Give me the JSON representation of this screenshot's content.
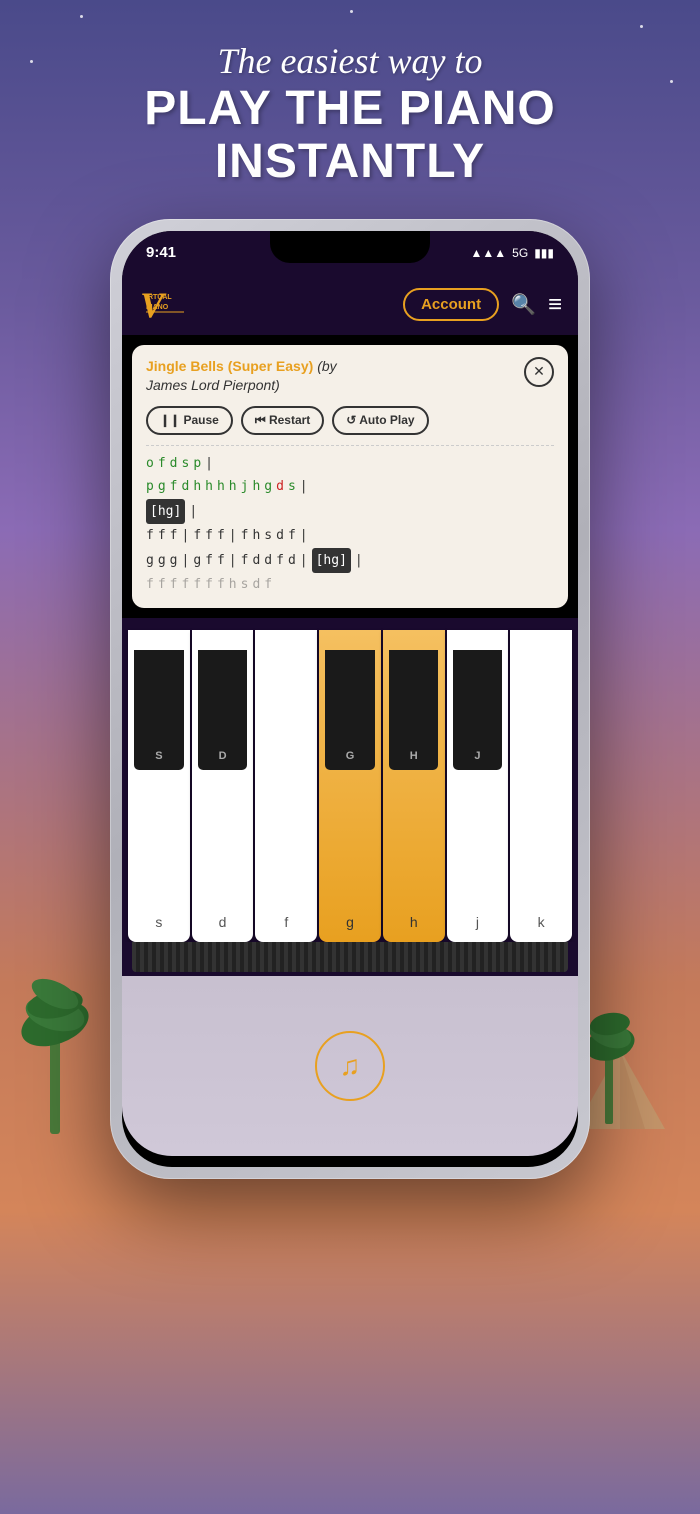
{
  "header": {
    "tagline": "The easiest way to",
    "main_line1": "PLAY THE PIANO",
    "main_line2": "INSTANTLY"
  },
  "status_bar": {
    "time": "9:41",
    "signal": "5G",
    "battery": "■■■"
  },
  "nav": {
    "logo_line1": "IRTUAL",
    "logo_line2": "PIANO",
    "account_label": "Account",
    "search_icon": "🔍",
    "menu_icon": "≡"
  },
  "song": {
    "title_bold": "Jingle Bells (Super Easy)",
    "title_italic": "(by",
    "title_author": "James Lord Pierpont)",
    "close_label": "×"
  },
  "controls": {
    "pause_label": "❙❙ Pause",
    "restart_label": "⏮ Restart",
    "autoplay_label": "↺ Auto Play"
  },
  "sheet": {
    "lines": [
      {
        "notes": [
          "o",
          "f",
          "d",
          "s",
          "p",
          "|"
        ],
        "classes": [
          "green",
          "green",
          "green",
          "green",
          "green",
          "dark"
        ]
      },
      {
        "notes": [
          "p",
          "g",
          "f",
          "d",
          "h",
          "h",
          "h",
          "h",
          "j",
          "h",
          "g",
          "d",
          "s",
          "|"
        ],
        "classes": [
          "green",
          "green",
          "green",
          "green",
          "green",
          "green",
          "green",
          "green",
          "green",
          "green",
          "green",
          "red",
          "green",
          "dark"
        ]
      },
      {
        "notes": [
          "[hg]",
          "|"
        ],
        "classes": [
          "current",
          "dark"
        ]
      },
      {
        "notes": [
          "f",
          "f",
          "f",
          "|",
          "f",
          "f",
          "f",
          "|",
          "f",
          "h",
          "s",
          "d",
          "f",
          "|"
        ],
        "classes": [
          "dark",
          "dark",
          "dark",
          "dark",
          "dark",
          "dark",
          "dark",
          "dark",
          "dark",
          "dark",
          "dark",
          "dark",
          "dark",
          "dark"
        ]
      },
      {
        "notes": [
          "g",
          "g",
          "g",
          "|",
          "g",
          "f",
          "f",
          "|",
          "f",
          "d",
          "d",
          "f",
          "d",
          "|",
          "[hg]",
          "|"
        ],
        "classes": [
          "dark",
          "dark",
          "dark",
          "dark",
          "dark",
          "dark",
          "dark",
          "dark",
          "dark",
          "dark",
          "dark",
          "dark",
          "dark",
          "dark",
          "current",
          "dark"
        ]
      },
      {
        "notes": [
          "f",
          "f",
          "f",
          "f",
          "f",
          "f",
          "f",
          "h",
          "s",
          "d",
          "f"
        ],
        "classes": [
          "dark",
          "dark",
          "dark",
          "dark",
          "dark",
          "dark",
          "dark",
          "dark",
          "dark",
          "dark",
          "dark"
        ]
      }
    ]
  },
  "piano": {
    "white_keys": [
      {
        "label": "s",
        "active": false
      },
      {
        "label": "d",
        "active": false
      },
      {
        "label": "f",
        "active": false
      },
      {
        "label": "g",
        "active": true
      },
      {
        "label": "h",
        "active": true
      },
      {
        "label": "j",
        "active": false
      },
      {
        "label": "k",
        "active": false
      }
    ],
    "black_keys_upper": [
      {
        "label": "S"
      },
      {
        "label": "D"
      },
      {
        "label": ""
      },
      {
        "label": "G"
      },
      {
        "label": "H"
      },
      {
        "label": "J"
      },
      {
        "label": ""
      }
    ]
  },
  "bottom": {
    "music_icon": "♫"
  },
  "colors": {
    "accent": "#e8a020",
    "background_dark": "#1a0a2e",
    "note_green": "#2a8a2a",
    "note_red": "#cc2222"
  }
}
